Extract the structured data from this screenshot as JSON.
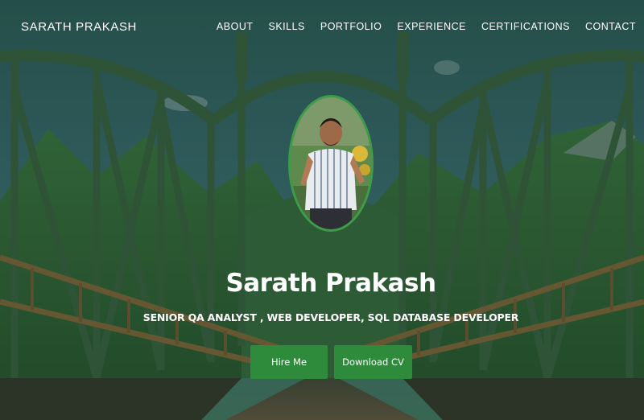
{
  "brand": "SARATH PRAKASH",
  "nav": [
    {
      "label": "ABOUT"
    },
    {
      "label": "SKILLS"
    },
    {
      "label": "PORTFOLIO"
    },
    {
      "label": "EXPERIENCE"
    },
    {
      "label": "CERTIFICATIONS"
    },
    {
      "label": "CONTACT"
    }
  ],
  "hero": {
    "name": "Sarath Prakash",
    "tagline": "SENIOR QA ANALYST , WEB DEVELOPER, SQL DATABASE DEVELOPER",
    "hire_label": "Hire Me",
    "cv_label": "Download CV"
  },
  "colors": {
    "accent": "#2e8b3c",
    "avatar_border": "#3d9c49",
    "bridge": "#3f6a45",
    "sky": "#3f6f78"
  }
}
